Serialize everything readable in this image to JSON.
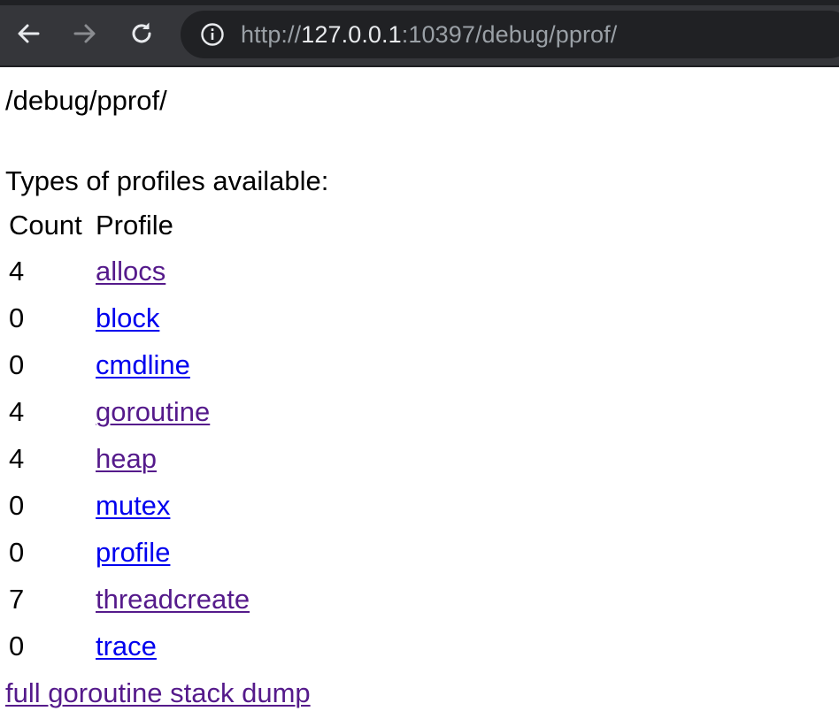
{
  "browser": {
    "url": {
      "scheme": "http://",
      "host": "127.0.0.1",
      "rest": ":10397/debug/pprof/"
    },
    "icons": {
      "back": "arrow-left-icon",
      "forward": "arrow-right-icon",
      "reload": "reload-icon",
      "site_info": "info-icon"
    },
    "colors": {
      "toolbar_bg": "#35363a",
      "omnibox_bg": "#202124",
      "url_dim": "#9aa0a6",
      "url_bright": "#e8eaed"
    }
  },
  "page": {
    "heading": "/debug/pprof/",
    "types_label": "Types of profiles available:",
    "table": {
      "headers": {
        "count": "Count",
        "profile": "Profile"
      },
      "rows": [
        {
          "count": "4",
          "name": "allocs",
          "visited": true
        },
        {
          "count": "0",
          "name": "block",
          "visited": false
        },
        {
          "count": "0",
          "name": "cmdline",
          "visited": false
        },
        {
          "count": "4",
          "name": "goroutine",
          "visited": true
        },
        {
          "count": "4",
          "name": "heap",
          "visited": true
        },
        {
          "count": "0",
          "name": "mutex",
          "visited": false
        },
        {
          "count": "0",
          "name": "profile",
          "visited": false
        },
        {
          "count": "7",
          "name": "threadcreate",
          "visited": true
        },
        {
          "count": "0",
          "name": "trace",
          "visited": false
        }
      ]
    },
    "trailing_link": "full goroutine stack dump",
    "colors": {
      "visited_link": "#551a8b",
      "unvisited_link": "#0000ee"
    }
  }
}
